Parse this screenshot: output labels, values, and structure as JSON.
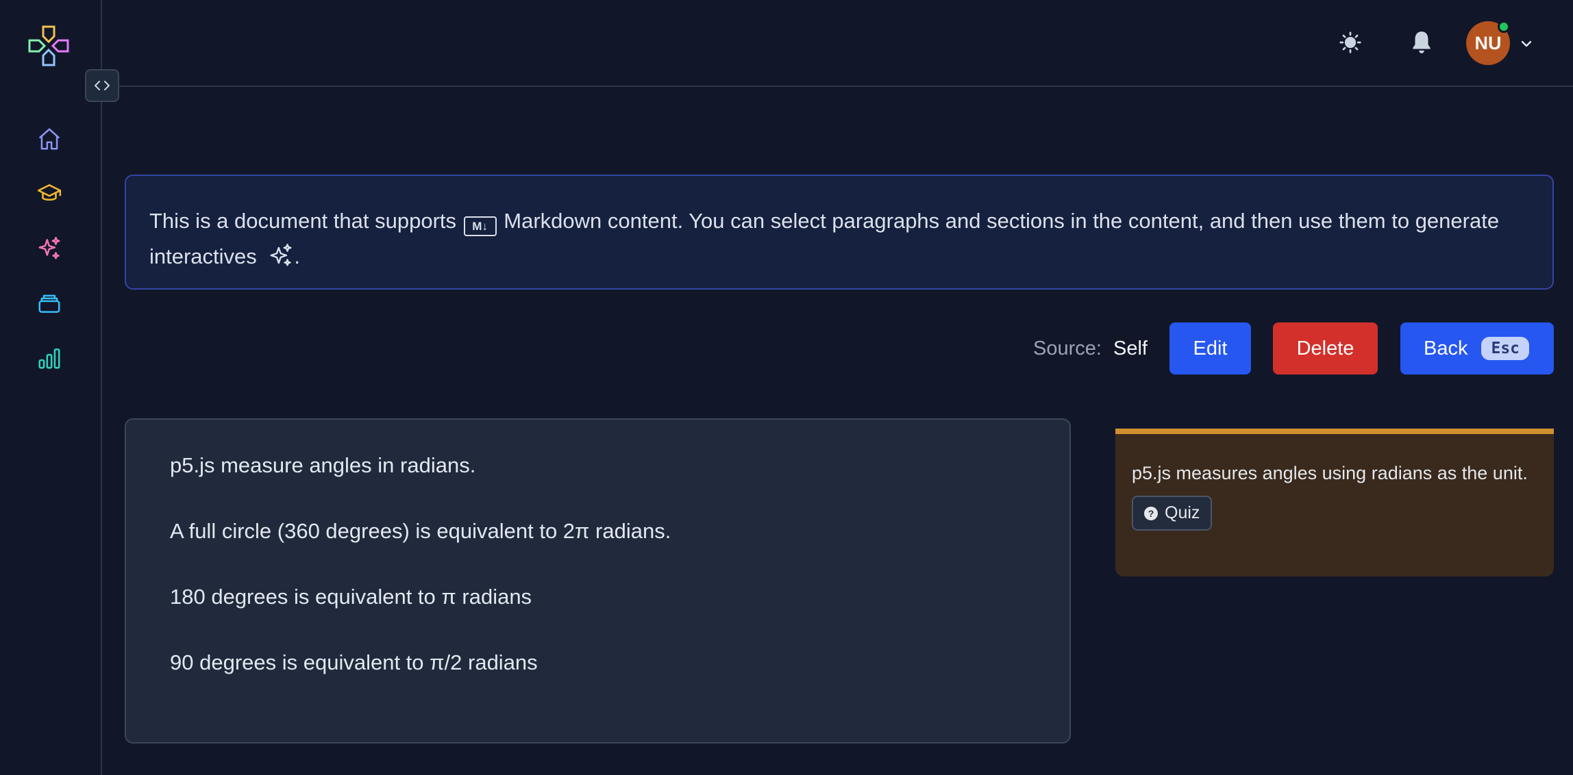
{
  "header": {
    "avatar_initials": "NU"
  },
  "banner": {
    "text_before": "This is a document that supports",
    "md_label": "M↓",
    "text_after": "Markdown content. You can select paragraphs and sections in the content, and then use them to generate interactives",
    "text_end": "."
  },
  "source": {
    "label": "Source:",
    "value": "Self"
  },
  "actions": {
    "edit_label": "Edit",
    "delete_label": "Delete",
    "back_label": "Back",
    "back_shortcut": "Esc"
  },
  "content": {
    "paragraphs": [
      "p5.js measure angles in radians.",
      "A full circle (360 degrees) is equivalent to 2π radians.",
      "180 degrees is equivalent to π radians",
      "90 degrees is equivalent to π/2 radians"
    ]
  },
  "note": {
    "text": "p5.js measures angles using radians as the unit.",
    "quiz_label": "Quiz",
    "accent_color": "#d1902f"
  },
  "colors": {
    "background": "#111729",
    "primary": "#2657f0",
    "danger": "#d4302b",
    "avatar": "#b4531f",
    "online": "#22c55e"
  },
  "icons": {
    "logo": "gamepad-cross-logo",
    "nav": [
      "home-icon",
      "graduation-cap-icon",
      "sparkles-icon",
      "stack-icon",
      "bar-chart-icon"
    ],
    "header": [
      "sun-icon",
      "bell-icon",
      "chevron-down-icon"
    ]
  }
}
